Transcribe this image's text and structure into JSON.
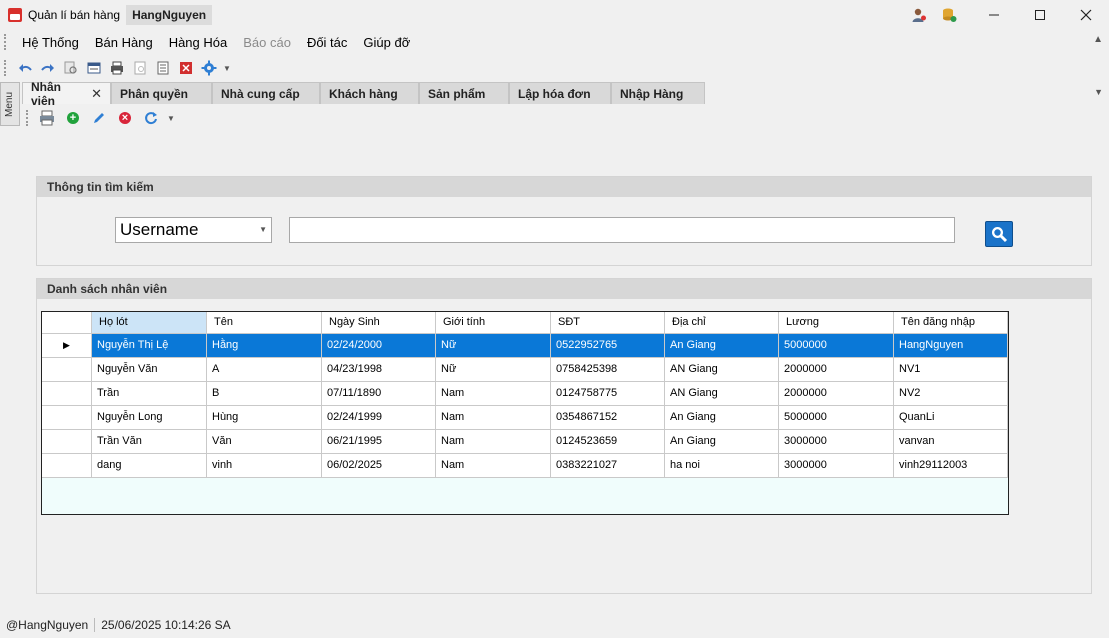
{
  "window": {
    "app_title": "Quản lí bán hàng",
    "user_badge": "HangNguyen"
  },
  "menu": [
    "Hệ Thống",
    "Bán Hàng",
    "Hàng Hóa",
    "Báo cáo",
    "Đối tác",
    "Giúp đỡ"
  ],
  "side_tab": "Menu",
  "tabs": [
    "Nhân viên",
    "Phân quyền",
    "Nhà cung cấp",
    "Khách hàng",
    "Sản phẩm",
    "Lập hóa đơn",
    "Nhập Hàng"
  ],
  "search_group": {
    "title": "Thông tin tìm kiếm",
    "field_select": "Username",
    "query": ""
  },
  "list_group": {
    "title": "Danh sách nhân viên"
  },
  "table": {
    "columns": [
      "Họ lót",
      "Tên",
      "Ngày Sinh",
      "Giới tính",
      "SĐT",
      "Địa chỉ",
      "Lương",
      "Tên đăng nhập"
    ],
    "rows": [
      [
        "Nguyễn Thị Lệ",
        "Hằng",
        "02/24/2000",
        "Nữ",
        "0522952765",
        "An Giang",
        "5000000",
        "HangNguyen"
      ],
      [
        "Nguyễn Văn",
        "A",
        "04/23/1998",
        "Nữ",
        "0758425398",
        "AN Giang",
        "2000000",
        "NV1"
      ],
      [
        "Trần",
        "B",
        "07/11/1890",
        "Nam",
        "0124758775",
        "AN Giang",
        "2000000",
        "NV2"
      ],
      [
        "Nguyễn Long",
        "Hùng",
        "02/24/1999",
        "Nam",
        "0354867152",
        "An Giang",
        "5000000",
        "QuanLi"
      ],
      [
        "Trần Văn",
        "Văn",
        "06/21/1995",
        "Nam",
        "0124523659",
        "An Giang",
        "3000000",
        "vanvan"
      ],
      [
        "dang",
        "vinh",
        "06/02/2025",
        "Nam",
        "0383221027",
        "ha noi",
        "3000000",
        "vinh29112003"
      ]
    ],
    "selected_row": 0
  },
  "status": {
    "user": "@HangNguyen",
    "datetime": "25/06/2025 10:14:26 SA"
  },
  "colors": {
    "selection": "#0a78d7",
    "grid_background": "#f0fdfc",
    "search_button": "#1a73c9"
  }
}
